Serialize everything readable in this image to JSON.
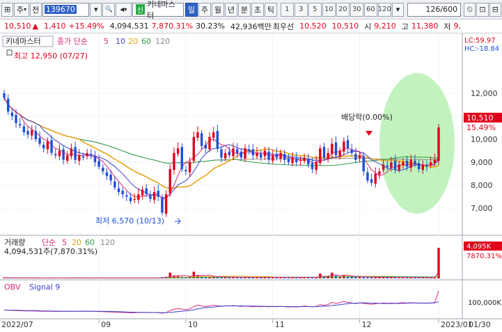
{
  "toolbar": {
    "menu_glyph": "⊞",
    "type_label": "주",
    "jeon_label": "전",
    "stock_code": "139670",
    "search_glyph": "🔍",
    "sound_glyph": "◀▾",
    "new_badge": "신",
    "stock_name": "키네마스터",
    "periods": [
      "일",
      "주",
      "월",
      "년",
      "분",
      "초",
      "틱"
    ],
    "active_period": "일",
    "intervals": [
      "1",
      "3",
      "5",
      "10",
      "20",
      "30",
      "60",
      "120"
    ],
    "dropdown_glyph": "▾",
    "page_counter": "126/600",
    "buttons_right": [
      "⏲",
      "⊡",
      "⊟"
    ]
  },
  "quote": {
    "price": "10,510",
    "arrow": "▲",
    "change": "1,410",
    "change_pct": "+15.49%",
    "volume": "4,094,531",
    "volume_ratio": "7,870.31%",
    "turnover": "30.23%",
    "amount": "42,936백만",
    "best_label": "최우선",
    "ask": "10,520",
    "bid": "10,510",
    "open_label": "시",
    "open": "9,210",
    "high_label": "고",
    "high": "11,380",
    "low_label": "저",
    "low": "9,"
  },
  "price_panel": {
    "legend_name": "키네마스터",
    "legend_ma_label": "종가 단순",
    "ma_periods": [
      "5",
      "10",
      "20",
      "60",
      "120"
    ],
    "lc_label": "LC:59.97",
    "hc_label": "HC:-18.84",
    "high_annotation": "최고 12,950 (07/27)",
    "low_annotation": "최저 6,570 (10/13)",
    "ex_div_annotation": "배당락(0.00%)",
    "current_price_tag": "10,510",
    "current_pct_tag": "15.49%"
  },
  "volume_panel": {
    "legend_name": "거래량",
    "legend_ma_label": "단순",
    "ma_periods": [
      "5",
      "20",
      "60",
      "120"
    ],
    "info": "4,094,531주(7,870.31%)",
    "value_tag": "4,095K",
    "pct_tag": "7870.31%"
  },
  "obv_panel": {
    "legend_name": "OBV",
    "legend_signal": "Signal 9",
    "axis_label": "100,000K"
  },
  "x_axis": {
    "labels": [
      "2022/07",
      "09",
      "10",
      "11",
      "12",
      "2023/01",
      "01/30"
    ]
  },
  "colors": {
    "up": "#e0001b",
    "down": "#1f4fd8",
    "ma5": "#d92a7a",
    "ma10": "#3c3fd0",
    "ma20": "#e8a317",
    "ma60": "#2f9e44",
    "ma120": "#8c8c8c",
    "highlight": "#7ee37a"
  },
  "chart_data": {
    "type": "candlestick",
    "price_axis": {
      "ticks": [
        7000,
        8000,
        9000,
        10000,
        11000,
        12000
      ]
    },
    "period_high": {
      "value": 12950,
      "date": "07/27"
    },
    "period_low": {
      "value": 6570,
      "date": "10/13"
    },
    "closes": [
      11800,
      11200,
      11000,
      10700,
      10600,
      10300,
      10200,
      10400,
      10000,
      9800,
      9600,
      9900,
      9400,
      9300,
      9500,
      9100,
      9300,
      9600,
      9100,
      9300,
      9200,
      9400,
      9300,
      9000,
      8800,
      8600,
      8400,
      8200,
      7900,
      7700,
      7600,
      7500,
      7300,
      7400,
      7600,
      7800,
      7600,
      7400,
      7700,
      7500,
      6800,
      7600,
      8700,
      9400,
      9600,
      8700,
      8600,
      9000,
      10100,
      10300,
      9700,
      9600,
      10100,
      10300,
      9600,
      9200,
      9400,
      9300,
      9600,
      9400,
      9200,
      9600,
      9500,
      9300,
      9400,
      9200,
      9500,
      9100,
      9300,
      9200,
      9400,
      9100,
      9000,
      9200,
      9000,
      9100,
      9200,
      8900,
      8700,
      9000,
      9600,
      9200,
      9400,
      9800,
      9300,
      9500,
      9900,
      9600,
      9400,
      9100,
      9300,
      8600,
      8200,
      8100,
      8500,
      8600,
      8900,
      8800,
      9000,
      8700,
      8900,
      9000,
      8800,
      9100,
      8900,
      8700,
      8900,
      8800,
      9000,
      9100,
      10510
    ],
    "volumes": [
      40,
      30,
      25,
      20,
      22,
      20,
      18,
      16,
      22,
      20,
      18,
      20,
      22,
      18,
      20,
      25,
      22,
      30,
      22,
      20,
      18,
      25,
      20,
      22,
      20,
      18,
      25,
      20,
      22,
      20,
      18,
      20,
      25,
      20,
      18,
      22,
      20,
      25,
      30,
      35,
      70,
      80,
      300,
      150,
      120,
      90,
      70,
      85,
      350,
      180,
      120,
      90,
      110,
      90,
      80,
      60,
      70,
      60,
      80,
      60,
      55,
      60,
      70,
      50,
      55,
      50,
      60,
      55,
      50,
      45,
      55,
      50,
      45,
      50,
      45,
      55,
      60,
      50,
      55,
      65,
      250,
      110,
      120,
      300,
      150,
      110,
      160,
      120,
      90,
      80,
      90,
      70,
      60,
      50,
      55,
      60,
      55,
      50,
      45,
      45,
      40,
      45,
      40,
      45,
      40,
      40,
      38,
      40,
      42,
      45,
      1600
    ]
  }
}
